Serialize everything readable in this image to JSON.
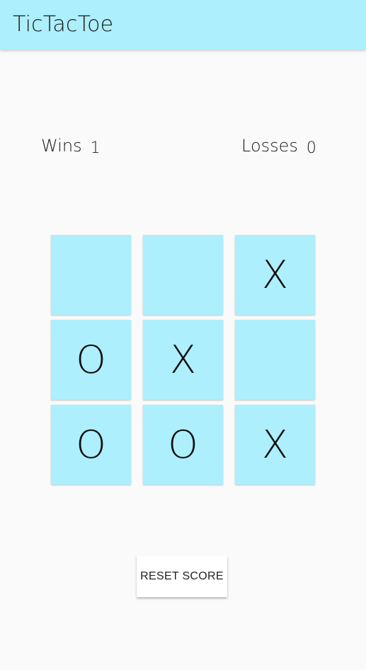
{
  "app_bar": {
    "title": "TicTacToe",
    "color": "#adeffc"
  },
  "score": {
    "wins_label": "Wins",
    "wins_value": "1",
    "losses_label": "Losses",
    "losses_value": "0"
  },
  "board": {
    "cells": [
      "",
      "",
      "X",
      "O",
      "X",
      "",
      "O",
      "O",
      "X"
    ],
    "cell_color": "#adeffc"
  },
  "reset_button": {
    "label": "RESET SCORE"
  }
}
